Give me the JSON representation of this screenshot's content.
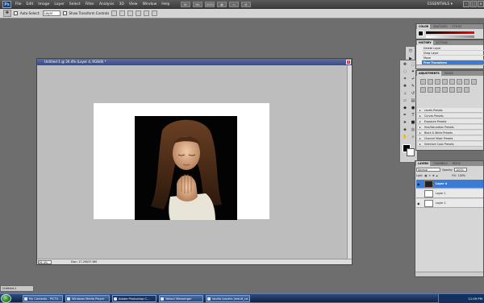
{
  "app": {
    "logo": "Ps",
    "menus": [
      "File",
      "Edit",
      "Image",
      "Layer",
      "Select",
      "Filter",
      "Analysis",
      "3D",
      "View",
      "Window",
      "Help"
    ],
    "app_tools": [
      "Br",
      "Mb",
      "100%",
      "▦",
      "▭",
      "⊞"
    ],
    "workspace": "ESSENTIALS ▾",
    "window_controls": [
      "–",
      "□",
      "×"
    ]
  },
  "options_bar": {
    "auto_select_label": "Auto-Select:",
    "auto_select_value": "Layer",
    "transform_label": "Show Transform Controls"
  },
  "document": {
    "title": "Untitled-1 @ 26.4% (Layer 4, RGB/8) *",
    "zoom": "26.4%",
    "info": "Doc: 17.2M/37.6M"
  },
  "color_panel": {
    "tabs": [
      "COLOR",
      "SWATCHES",
      "STYLES"
    ]
  },
  "history_panel": {
    "tabs": [
      "HISTORY",
      "ACTIONS"
    ],
    "rows": [
      "Delete Layer",
      "Drag Layer",
      "Move",
      "Free Transform"
    ],
    "selected_index": 3
  },
  "adjustments_panel": {
    "tabs": [
      "ADJUSTMENTS",
      "MASKS"
    ],
    "presets": [
      "Levels Presets",
      "Curves Presets",
      "Exposure Presets",
      "Hue/Saturation Presets",
      "Black & White Presets",
      "Channel Mixer Presets",
      "Selective Color Presets"
    ]
  },
  "layers_panel": {
    "tabs": [
      "LAYERS",
      "CHANNELS",
      "PATHS"
    ],
    "blend_mode": "Normal",
    "opacity_label": "Opacity:",
    "opacity_value": "100%",
    "lock_label": "Lock:",
    "fill_label": "Fill:",
    "fill_value": "100%",
    "layers": [
      "Layer 4",
      "Layer 1",
      "Layer 1"
    ]
  },
  "minimized_doc": "Untitled-1",
  "taskbar": {
    "items": [
      "My Contests - PICTU...",
      "Windows Media Player",
      "Adobe Photoshop C...",
      "Yahoo! Messenger",
      "studio (savers (result_co..."
    ],
    "active_index": 2,
    "clock": "11:09 PM"
  },
  "colors": {
    "accent": "#3a7bd5",
    "menubar": "#4a4a4a",
    "taskbar": "#1d3a6b"
  }
}
